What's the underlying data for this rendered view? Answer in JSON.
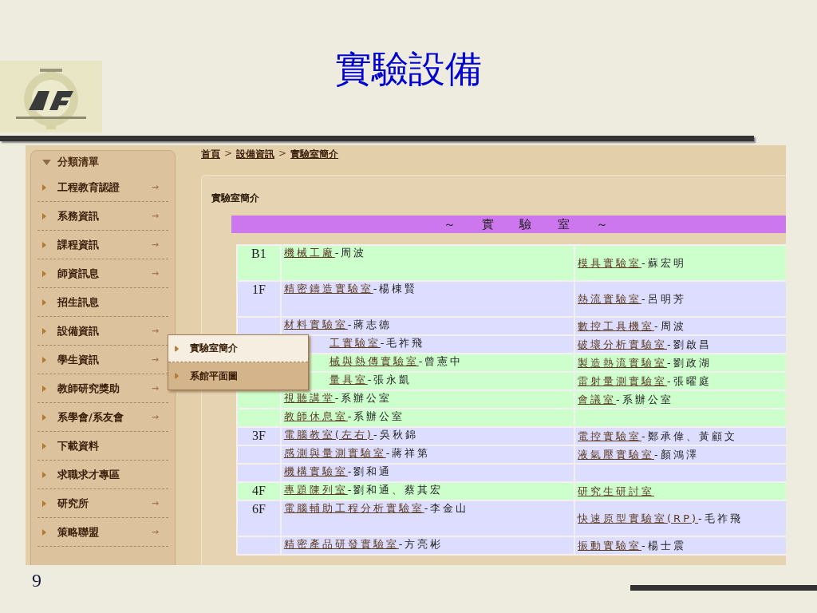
{
  "slide": {
    "title": "實驗設備",
    "page_number": "9"
  },
  "sidebar": {
    "header": "分類清單",
    "items": [
      {
        "label": "工程教育認證",
        "arrow": "→"
      },
      {
        "label": "系務資訊",
        "arrow": "→"
      },
      {
        "label": "課程資訊",
        "arrow": "→"
      },
      {
        "label": "師資訊息",
        "arrow": "→"
      },
      {
        "label": "招生訊息"
      },
      {
        "label": "設備資訊",
        "arrow": "→"
      },
      {
        "label": "學生資訊",
        "arrow": "→"
      },
      {
        "label": "教師研究獎助",
        "arrow": "→"
      },
      {
        "label": "系學會/系友會",
        "arrow": "→"
      },
      {
        "label": "下載資料"
      },
      {
        "label": "求職求才專區"
      },
      {
        "label": "研究所",
        "arrow": "→"
      },
      {
        "label": "策略聯盟",
        "arrow": "→"
      }
    ]
  },
  "flyout": [
    {
      "label": "實驗室簡介",
      "selected": true
    },
    {
      "label": "系館平面圖",
      "selected": false
    }
  ],
  "breadcrumb": [
    {
      "kind": "link",
      "label": "首頁"
    },
    {
      "kind": "separator",
      "label": ">"
    },
    {
      "kind": "link",
      "label": "設備資訊"
    },
    {
      "kind": "separator",
      "label": ">"
    },
    {
      "kind": "link",
      "label": "實驗室簡介"
    }
  ],
  "panel": {
    "heading": "實驗室簡介",
    "banner": "～ 實 驗 室 ～"
  },
  "table": {
    "rows": [
      {
        "floor": "B1",
        "color": "#ccffcc",
        "kind": "tall",
        "cells": [
          {
            "link": "機械工廠",
            "rest": "-周波"
          },
          {
            "link": "模具實驗室",
            "rest": "-蘇宏明"
          }
        ]
      },
      {
        "floor": "1F",
        "color": "#ddddff",
        "kind": "tall",
        "cells": [
          {
            "link": "精密鑄造實驗室",
            "rest": "-楊棟賢"
          },
          {
            "link": "熱流實驗室",
            "rest": "-呂明芳"
          }
        ]
      },
      {
        "color": "#ddddff",
        "kind": "normal",
        "cells": [
          {
            "link": "材料實驗室",
            "rest": "-蔣志德"
          },
          {
            "link": "數控工具機室",
            "rest": "-周波"
          }
        ]
      },
      {
        "color": "#ddddff",
        "kind": "normal",
        "cells": [
          {
            "kind": "covered",
            "link": "工實驗室",
            "rest": "-毛祚飛"
          },
          {
            "link": "破壞分析實驗室",
            "rest": "-劉啟昌"
          }
        ]
      },
      {
        "color": "#ccffcc",
        "kind": "normal",
        "cells": [
          {
            "kind": "covered",
            "link": "械與熱傳實驗室",
            "rest": "-曾憲中"
          },
          {
            "link": "製造熱流實驗室",
            "rest": "-劉政湖"
          }
        ]
      },
      {
        "color": "#ccffcc",
        "kind": "normal",
        "cells": [
          {
            "kind": "covered",
            "link": "量具室",
            "rest": "-張永凱"
          },
          {
            "link": "雷射量測實驗室",
            "rest": "-張曜庭"
          }
        ]
      },
      {
        "color": "#ccffcc",
        "kind": "normal",
        "cells": [
          {
            "link": "視聽講堂",
            "rest": "-系辦公室"
          },
          {
            "link": "會議室",
            "rest": "-系辦公室"
          }
        ]
      },
      {
        "color": "#ccffcc",
        "kind": "normal",
        "cells": [
          {
            "link": "教師休息室",
            "rest": "-系辦公室"
          },
          {}
        ]
      },
      {
        "floor": "3F",
        "color": "#ddddff",
        "kind": "normal",
        "cells": [
          {
            "link": "電腦教室(左右)",
            "rest": "-吳秋錦"
          },
          {
            "link": "電控實驗室",
            "rest": "-鄭承偉、黃顧文"
          }
        ]
      },
      {
        "color": "#ddddff",
        "kind": "normal",
        "cells": [
          {
            "link": "感測與量測實驗室",
            "rest": "-蔣祥第"
          },
          {
            "link": "液氣壓實驗室",
            "rest": "-顏鴻澤"
          }
        ]
      },
      {
        "color": "#ddddff",
        "kind": "normal",
        "cells": [
          {
            "link": "機構實驗室",
            "rest": "-劉和通"
          },
          {}
        ]
      },
      {
        "floor": "4F",
        "color": "#ccffcc",
        "kind": "normal",
        "cells": [
          {
            "link": "專題陳列室",
            "rest": "-劉和通、蔡其宏"
          },
          {
            "link": "研究生研討室"
          }
        ]
      },
      {
        "floor": "6F",
        "color": "#ddddff",
        "kind": "tall",
        "cells": [
          {
            "link": "電腦輔助工程分析實驗室",
            "rest": "-李金山"
          },
          {
            "link": "快速原型實驗室(RP)",
            "rest": "-毛祚飛"
          }
        ]
      },
      {
        "color": "#ddddff",
        "kind": "normal",
        "cells": [
          {
            "link": "精密產品研發實驗室",
            "rest": "-方亮彬"
          },
          {
            "link": "振動實驗室",
            "rest": "-楊士震"
          }
        ]
      }
    ]
  }
}
